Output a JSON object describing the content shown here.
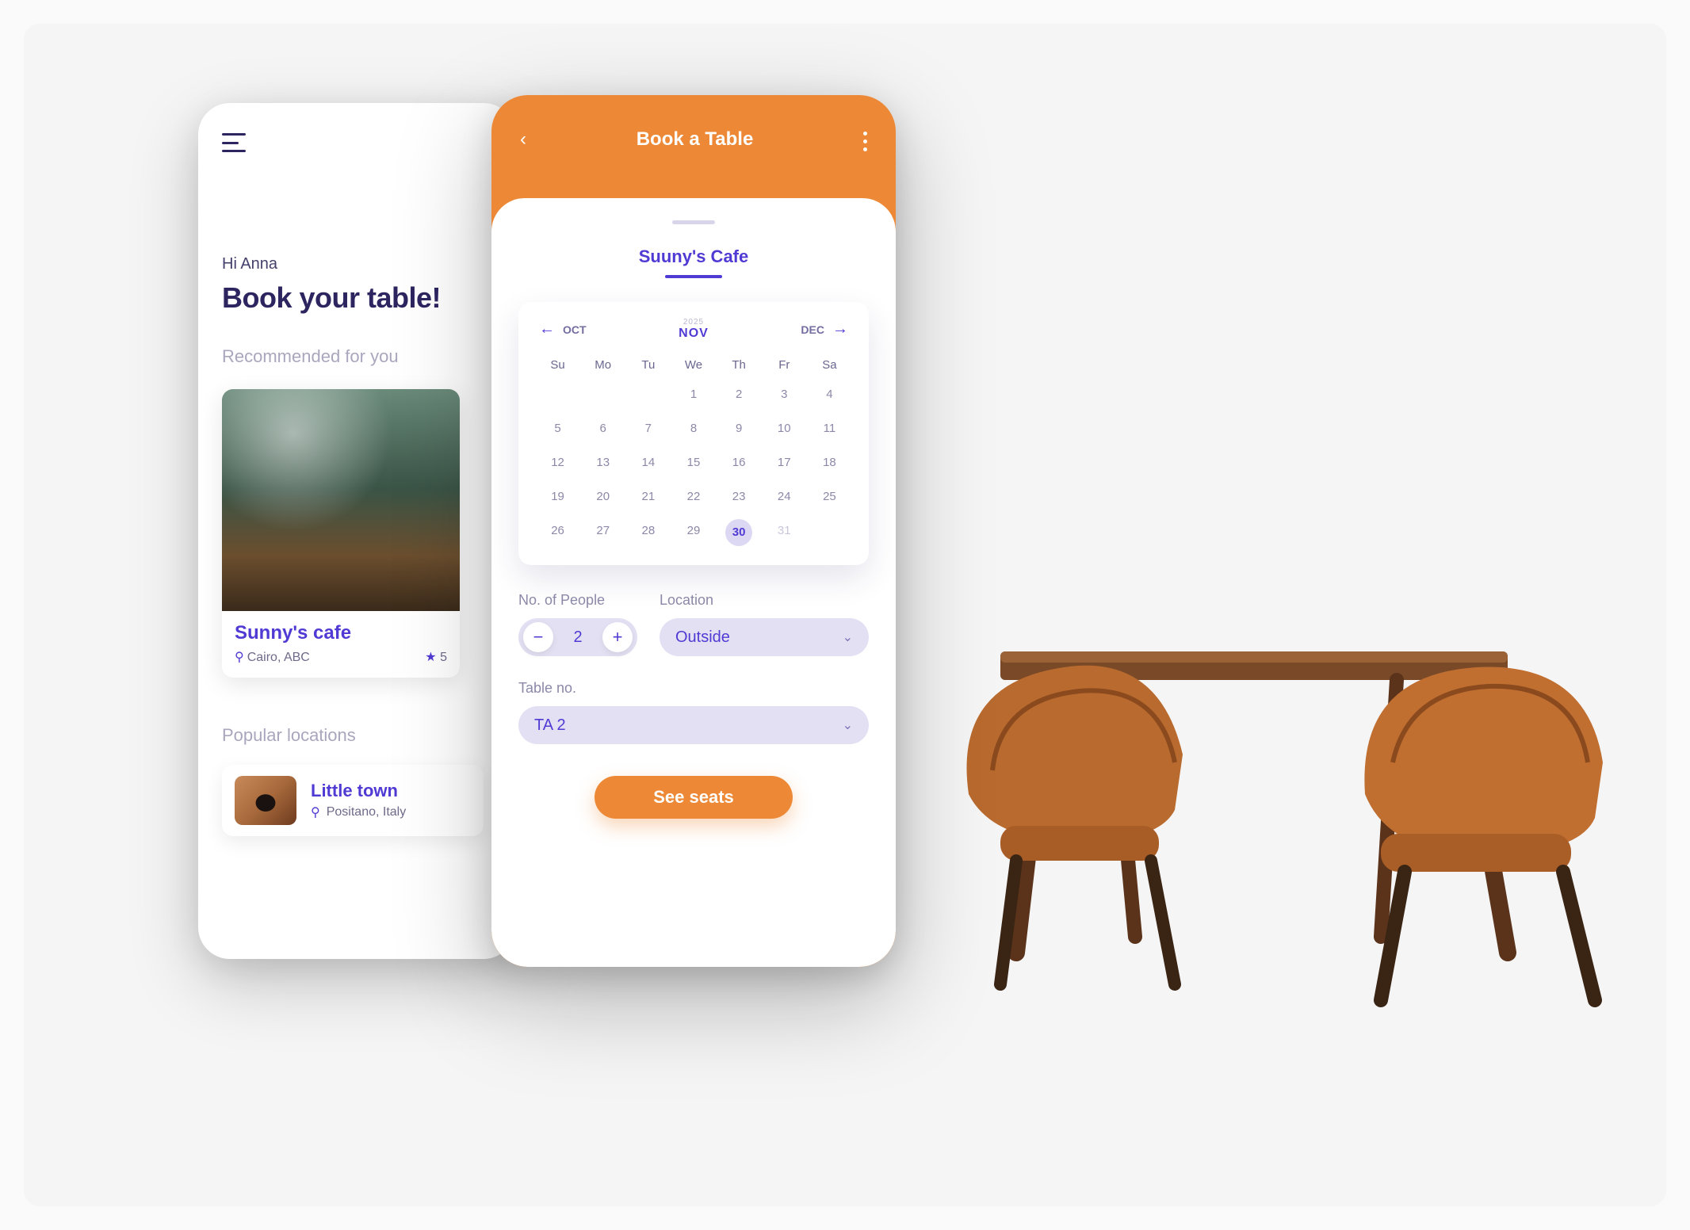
{
  "colors": {
    "accent": "#ed8936",
    "primary": "#4f3bd4",
    "muted": "#8c88a8",
    "pill": "#e4e0f3"
  },
  "left": {
    "greeting": "Hi Anna",
    "hero": "Book your table!",
    "recommended_label": "Recommended for you",
    "card": {
      "title": "Sunny's cafe",
      "location": "Cairo, ABC",
      "rating": "5"
    },
    "popular_label": "Popular locations",
    "popular": {
      "title": "Little town",
      "location": "Positano, Italy"
    }
  },
  "right": {
    "topbar_title": "Book a Table",
    "cafe_name": "Suuny's Cafe",
    "calendar": {
      "prev": "OCT",
      "year": "2025",
      "month": "NOV",
      "next": "DEC",
      "dows": [
        "Su",
        "Mo",
        "Tu",
        "We",
        "Th",
        "Fr",
        "Sa"
      ],
      "weeks": [
        [
          "",
          "",
          "",
          "1",
          "2",
          "3",
          "4"
        ],
        [
          "5",
          "6",
          "7",
          "8",
          "9",
          "10",
          "11"
        ],
        [
          "12",
          "13",
          "14",
          "15",
          "16",
          "17",
          "18"
        ],
        [
          "19",
          "20",
          "21",
          "22",
          "23",
          "24",
          "25"
        ],
        [
          "26",
          "27",
          "28",
          "29",
          "30",
          "31",
          ""
        ]
      ],
      "selected": "30",
      "dimmed": [
        "31"
      ]
    },
    "people_label": "No. of People",
    "people_value": "2",
    "location_label": "Location",
    "location_value": "Outside",
    "table_label": "Table no.",
    "table_value": "TA 2",
    "cta": "See seats"
  }
}
